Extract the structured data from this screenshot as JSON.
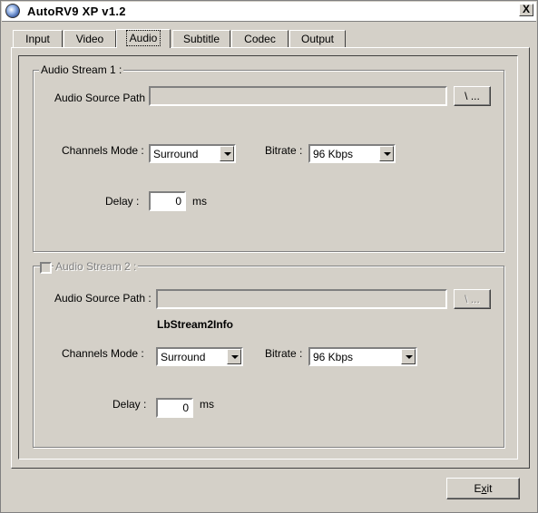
{
  "window": {
    "title": "AutoRV9  XP  v1.2",
    "close_label": "X"
  },
  "tabs": [
    {
      "label": "Input"
    },
    {
      "label": "Video"
    },
    {
      "label": "Audio"
    },
    {
      "label": "Subtitle"
    },
    {
      "label": "Codec"
    },
    {
      "label": "Output"
    }
  ],
  "stream1": {
    "legend": "Audio Stream 1 :",
    "source_path_label": "Audio Source Path :",
    "source_path_value": "",
    "browse_label": "\\ ...",
    "channels_label": "Channels Mode :",
    "channels_value": "Surround",
    "bitrate_label": "Bitrate :",
    "bitrate_value": "96  Kbps",
    "delay_label": "Delay :",
    "delay_value": "0",
    "delay_unit": "ms"
  },
  "stream2": {
    "legend": "Audio Stream 2 :",
    "source_path_label": "Audio Source Path :",
    "source_path_value": "",
    "browse_label": "\\ ...",
    "info_label": "LbStream2Info",
    "channels_label": "Channels Mode :",
    "channels_value": "Surround",
    "bitrate_label": "Bitrate :",
    "bitrate_value": "96  Kbps",
    "delay_label": "Delay :",
    "delay_value": "0",
    "delay_unit": "ms"
  },
  "footer": {
    "exit_prefix": "E",
    "exit_underlined": "x",
    "exit_suffix": "it"
  }
}
